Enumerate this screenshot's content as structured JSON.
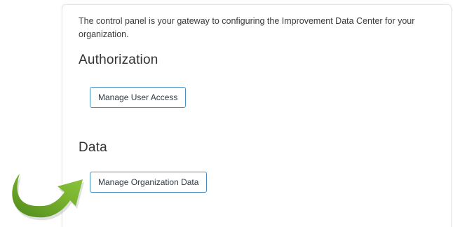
{
  "intro_text": "The control panel is your gateway to configuring the Improvement Data Center for your organization.",
  "sections": {
    "authorization": {
      "title": "Authorization",
      "button_label": "Manage User Access"
    },
    "data": {
      "title": "Data",
      "button_label": "Manage Organization Data"
    }
  },
  "colors": {
    "button_border": "#4a8fc4",
    "arrow_green": "#7ab32e",
    "arrow_green_dark": "#4f8a1c"
  },
  "icons": {
    "pointer": "curved-arrow-icon"
  }
}
